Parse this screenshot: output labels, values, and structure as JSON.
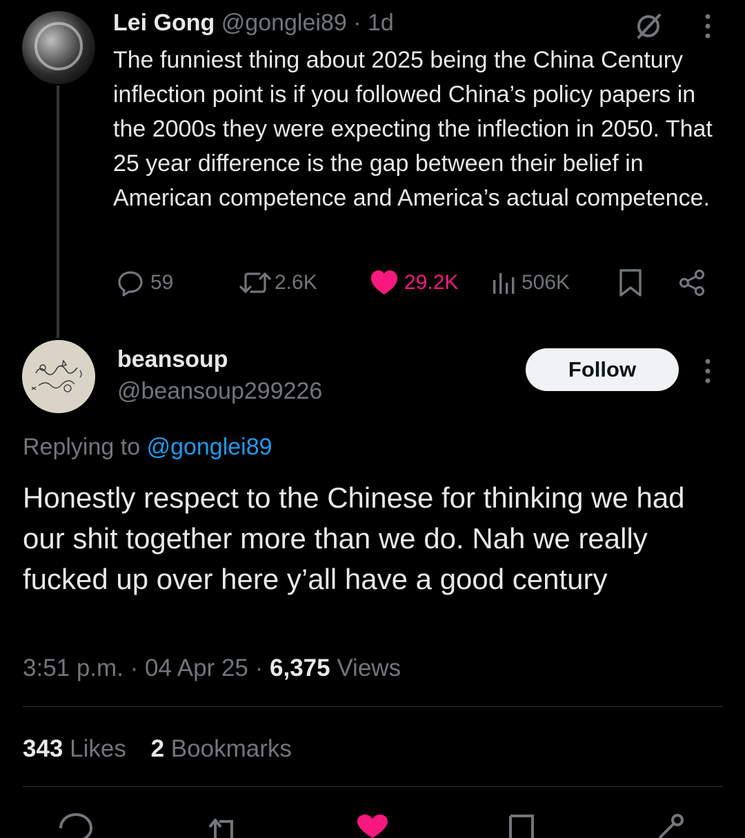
{
  "parent_tweet": {
    "author_name": "Lei Gong",
    "author_handle": "@gonglei89",
    "separator": "·",
    "time_ago": "1d",
    "text": "The funniest thing about 2025 being the China Century inflection point is if you followed China’s policy papers in the 2000s they were expecting the inflection in 2050. That 25 year difference is the gap between their belief in American competence and America’s actual competence.",
    "actions": {
      "replies": "59",
      "reposts": "2.6K",
      "likes": "29.2K",
      "views": "506K"
    },
    "icons": [
      "grok-icon",
      "more-icon",
      "reply-icon",
      "repost-icon",
      "like-icon",
      "views-icon",
      "bookmark-icon",
      "share-icon"
    ]
  },
  "reply_tweet": {
    "author_name": "beansoup",
    "author_handle": "@beansoup299226",
    "follow_label": "Follow",
    "replying_prefix": "Replying to",
    "replying_mention": "@gonglei89",
    "text": "Honestly respect to the Chinese for thinking we had our shit together more than we do. Nah we really fucked up over here y’all have a good century",
    "time": "3:51 p.m.",
    "date": "04 Apr 25",
    "views_count": "6,375",
    "views_label": "Views",
    "likes_count": "343",
    "likes_label": "Likes",
    "bookmarks_count": "2",
    "bookmarks_label": "Bookmarks"
  },
  "colors": {
    "background": "#000000",
    "text": "#e7e9ea",
    "muted": "#71767b",
    "link": "#1d9bf0",
    "like": "#f91880"
  }
}
